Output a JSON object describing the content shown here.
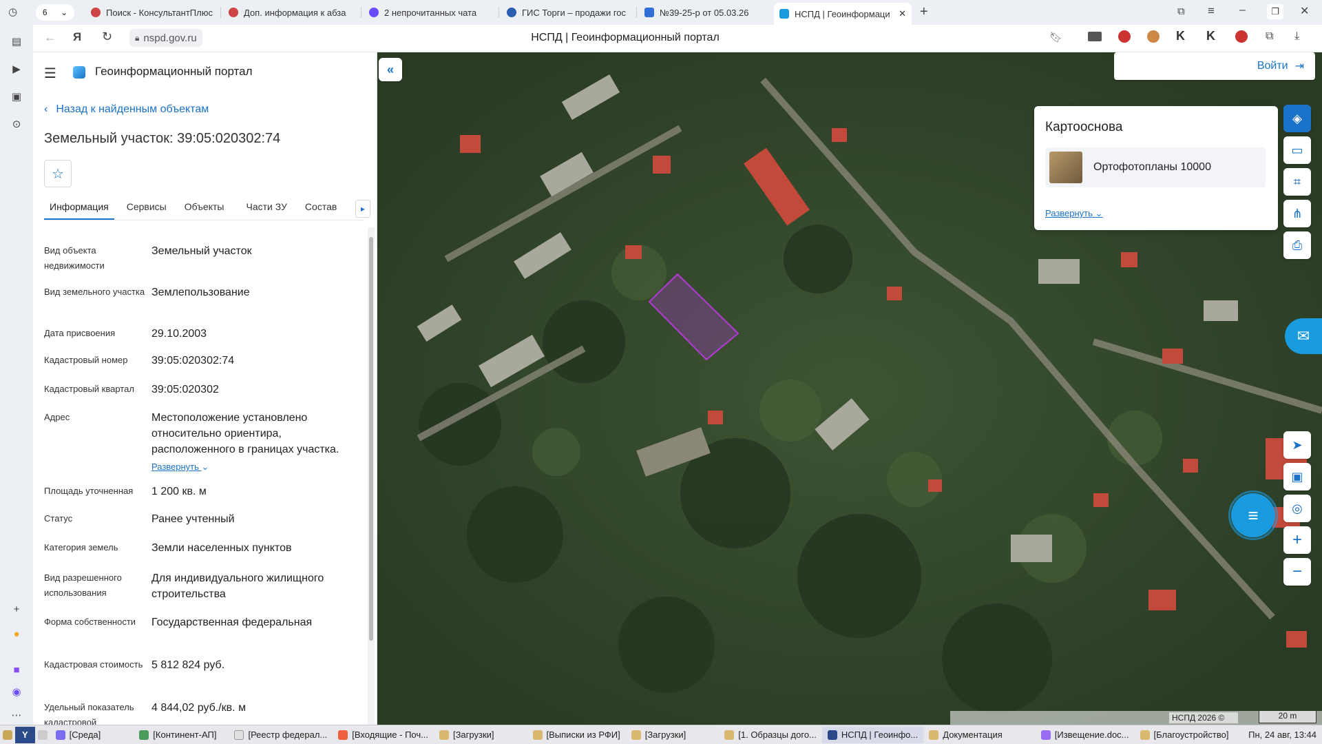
{
  "browser": {
    "tab_count": "6",
    "tabs": [
      {
        "label": "Поиск - КонсультантПлюс"
      },
      {
        "label": "Доп. информация к абза"
      },
      {
        "label": "2 непрочитанных чата"
      },
      {
        "label": "ГИС Торги – продажи гос"
      },
      {
        "label": "№39-25-р от 05.03.26"
      },
      {
        "label": "НСПД | Геоинформаци"
      }
    ],
    "url": "nspd.gov.ru",
    "page_title": "НСПД | Геоинформационный портал"
  },
  "header": {
    "title": "Геоинформационный портал"
  },
  "back_link": "Назад к найденным объектам",
  "object_title": "Земельный участок: 39:05:020302:74",
  "info_tabs": [
    "Информация",
    "Сервисы",
    "Объекты",
    "Части ЗУ",
    "Состав"
  ],
  "fields": [
    {
      "key": "Вид объекта недвижимости",
      "value": "Земельный участок"
    },
    {
      "key": "Вид земельного участка",
      "value": "Землепользование"
    },
    {
      "key": "Дата присвоения",
      "value": "29.10.2003"
    },
    {
      "key": "Кадастровый номер",
      "value": "39:05:020302:74"
    },
    {
      "key": "Кадастровый квартал",
      "value": "39:05:020302"
    },
    {
      "key": "Адрес",
      "value": "Местоположение установлено относительно ориентира, расположенного в границах участка."
    },
    {
      "key": "Площадь уточненная",
      "value": "1 200 кв. м"
    },
    {
      "key": "Статус",
      "value": "Ранее учтенный"
    },
    {
      "key": "Категория земель",
      "value": "Земли населенных пунктов"
    },
    {
      "key": "Вид разрешенного использования",
      "value": "Для индивидуального жилищного строительства"
    },
    {
      "key": "Форма собственности",
      "value": "Государственная федеральная"
    },
    {
      "key": "Кадастровая стоимость",
      "value": "5 812 824 руб."
    },
    {
      "key": "Удельный показатель кадастровой",
      "value": "4 844,02 руб./кв. м"
    }
  ],
  "address_expand": "Развернуть",
  "map": {
    "login": "Войти",
    "basemap_title": "Картооснова",
    "basemap_layer": "Ортофотопланы 10000",
    "basemap_expand": "Развернуть",
    "copyright": "НСПД 2026 ©",
    "scale": "20 m"
  },
  "taskbar": {
    "items": [
      "[Среда]",
      "[Континент-АП]",
      "[Реестр федерал...",
      "[Входящие - Поч...",
      "[Загрузки]",
      "[Выписки из РФИ]",
      "[Загрузки]",
      "[1. Образцы дого...",
      "НСПД | Геоинфо...",
      "Документация",
      "[Извещение.doc...",
      "[Благоустройство]"
    ],
    "clock": "Пн, 24 авг, 13:44"
  },
  "colors": {
    "accent": "#1a73c8",
    "parcel": "#b23ad6"
  }
}
